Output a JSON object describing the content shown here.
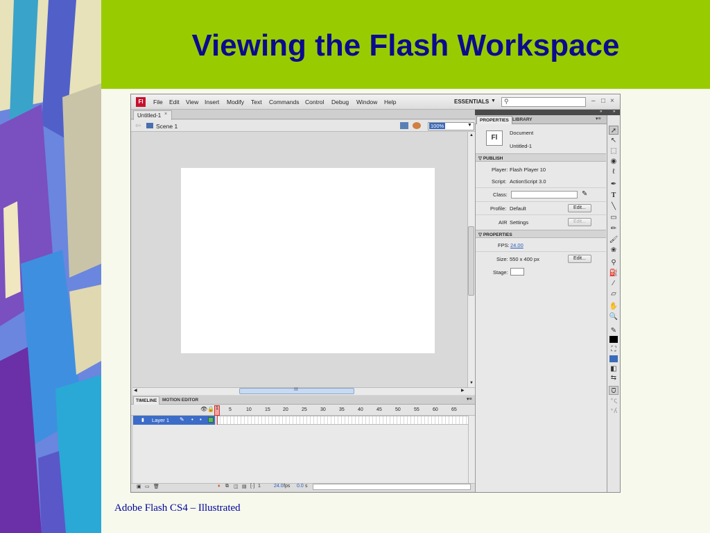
{
  "slide": {
    "title": "Viewing the Flash Workspace",
    "caption": "Adobe Flash CS4 – Illustrated",
    "banner_color": "#99cc00",
    "title_color": "#0b0b8e"
  },
  "app": {
    "logo": "Fl",
    "menu": [
      "File",
      "Edit",
      "View",
      "Insert",
      "Modify",
      "Text",
      "Commands",
      "Control",
      "Debug",
      "Window",
      "Help"
    ],
    "workspace": "ESSENTIALS",
    "search_placeholder": "",
    "window_buttons": [
      "–",
      "□",
      "×"
    ]
  },
  "document": {
    "tab_label": "Untitled-1",
    "tab_close": "×",
    "scene_label": "Scene 1",
    "zoom": "100%",
    "scroll_grip": "III"
  },
  "timeline": {
    "tabs": [
      "TIMELINE",
      "MOTION EDITOR"
    ],
    "frame_numbers": [
      "1",
      "5",
      "10",
      "15",
      "20",
      "25",
      "30",
      "35",
      "40",
      "45",
      "50",
      "55",
      "60",
      "65"
    ],
    "layer_name": "Layer 1",
    "current_frame": "1",
    "fps": "24.0",
    "fps_unit": "fps",
    "elapsed": "0.0",
    "elapsed_unit": "s"
  },
  "properties": {
    "tabs": [
      "PROPERTIES",
      "LIBRARY"
    ],
    "doc_icon": "Fl",
    "doc_type": "Document",
    "doc_name": "Untitled-1",
    "publish_header": "PUBLISH",
    "player_label": "Player:",
    "player_value": "Flash Player 10",
    "script_label": "Script:",
    "script_value": "ActionScript 3.0",
    "class_label": "Class:",
    "profile_label": "Profile:",
    "profile_value": "Default",
    "edit_label": "Edit...",
    "air_label": "AIR",
    "air_value": "Settings",
    "properties_header": "PROPERTIES",
    "fps_label": "FPS:",
    "fps_value": "24.00",
    "size_label": "Size:",
    "size_value": "550 x 400 px",
    "stage_label": "Stage:",
    "stage_color": "#ffffff"
  },
  "tools": [
    "selection-tool-icon",
    "subselection-tool-icon",
    "free-transform-tool-icon",
    "3d-rotation-tool-icon",
    "lasso-tool-icon",
    "pen-tool-icon",
    "text-tool-icon",
    "line-tool-icon",
    "rectangle-tool-icon",
    "pencil-tool-icon",
    "brush-tool-icon",
    "deco-tool-icon",
    "bone-tool-icon",
    "paint-bucket-tool-icon",
    "eyedropper-tool-icon",
    "eraser-tool-icon",
    "hand-tool-icon",
    "zoom-tool-icon"
  ]
}
